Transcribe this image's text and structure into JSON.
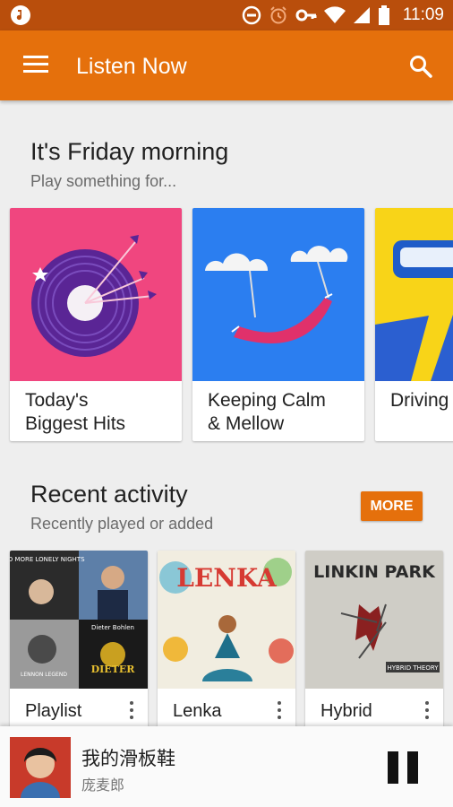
{
  "status_bar": {
    "time": "11:09",
    "icons": [
      "music-note-icon",
      "dnd-icon",
      "alarm-icon",
      "vpn-key-icon",
      "wifi-icon",
      "signal-icon",
      "battery-icon"
    ]
  },
  "app_bar": {
    "title": "Listen Now",
    "menu_icon": "hamburger-menu-icon",
    "search_icon": "search-icon",
    "color": "#e5700c"
  },
  "friday_section": {
    "title": "It's Friday morning",
    "subtitle": "Play something for...",
    "cards": [
      {
        "line1": "Today's",
        "line2": "Biggest Hits",
        "color": "#f0467f"
      },
      {
        "line1": "Keeping Calm",
        "line2": "& Mellow",
        "color": "#2b7ef0"
      },
      {
        "line1": "Driving",
        "line2": "",
        "color": "#f8d418"
      }
    ]
  },
  "recent_section": {
    "title": "Recent activity",
    "subtitle": "Recently played or added",
    "more_label": "MORE",
    "items": [
      {
        "label": "Playlist",
        "album_text": [
          "NO MORE LONELY NIGHTS",
          "Dieter Bohlen",
          "LENNON LEGEND",
          "DIETER"
        ]
      },
      {
        "label": "Lenka",
        "album_text": [
          "LENKA"
        ]
      },
      {
        "label": "Hybrid",
        "album_text": [
          "LINKIN PARK",
          "HYBRID THEORY"
        ]
      }
    ]
  },
  "now_playing": {
    "song": "我的滑板鞋",
    "artist": "庞麦郎",
    "control_icon": "pause-icon"
  }
}
